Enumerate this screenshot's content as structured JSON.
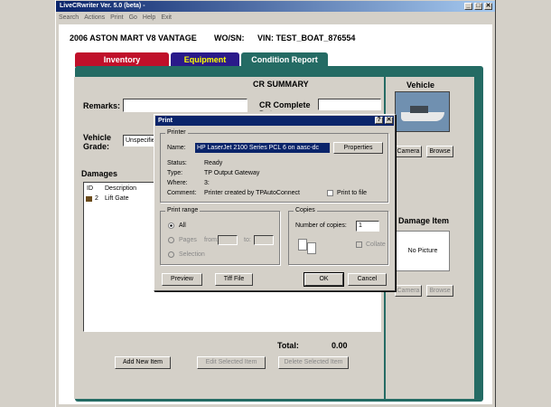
{
  "window": {
    "title": "LiveCRwriter Ver. 5.0 (beta) -",
    "min": "_",
    "max": "□",
    "close": "✕"
  },
  "menu": [
    "Search",
    "Actions",
    "Print",
    "Go",
    "Help",
    "Exit"
  ],
  "vehicle": {
    "year_model": "2006  ASTON MART V8 VANTAGE",
    "wo": "WO/SN:",
    "vin": "VIN: TEST_BOAT_876554"
  },
  "tabs": [
    {
      "label": "Inventory",
      "color": "#c0102a"
    },
    {
      "label": "Equipment",
      "color": "#2a1a8a",
      "text": "#ffff00"
    },
    {
      "label": "Condition Report",
      "color": "#246b64"
    }
  ],
  "cr": {
    "summary": "CR SUMMARY",
    "remarks": "Remarks:",
    "complete": "CR Complete Date:",
    "grade": "Vehicle Grade:",
    "grade_value": "Unspecifie",
    "damages": "Damages",
    "col_id": "ID",
    "col_desc": "Description",
    "row_id": "2",
    "row_desc": "Lift Gate",
    "total_label": "Total:",
    "total_value": "0.00",
    "add_btn": "Add New Item",
    "edit_btn": "Edit Selected Item",
    "delete_btn": "Delete Selected Item"
  },
  "side": {
    "vehicle": "Vehicle",
    "camera": "Camera",
    "browse": "Browse",
    "damage_item": "Damage Item",
    "no_picture": "No Picture"
  },
  "dialog": {
    "title": "Print",
    "help": "?",
    "close": "✕",
    "printer_group": "Printer",
    "name_label": "Name:",
    "name_value": "HP LaserJet 2100 Series PCL 6 on aasc-dc",
    "properties": "Properties",
    "status_label": "Status:",
    "status_value": "Ready",
    "type_label": "Type:",
    "type_value": "TP Output Gateway",
    "where_label": "Where:",
    "where_value": "3:",
    "comment_label": "Comment:",
    "comment_value": "Printer created by TPAutoConnect",
    "print_to_file": "Print to file",
    "range_group": "Print range",
    "all": "All",
    "pages": "Pages",
    "from": "from:",
    "to": "to:",
    "selection": "Selection",
    "copies_group": "Copies",
    "num_copies": "Number of copies:",
    "copies_value": "1",
    "collate": "Collate",
    "preview": "Preview",
    "tiff": "Tiff File",
    "ok": "OK",
    "cancel": "Cancel"
  }
}
